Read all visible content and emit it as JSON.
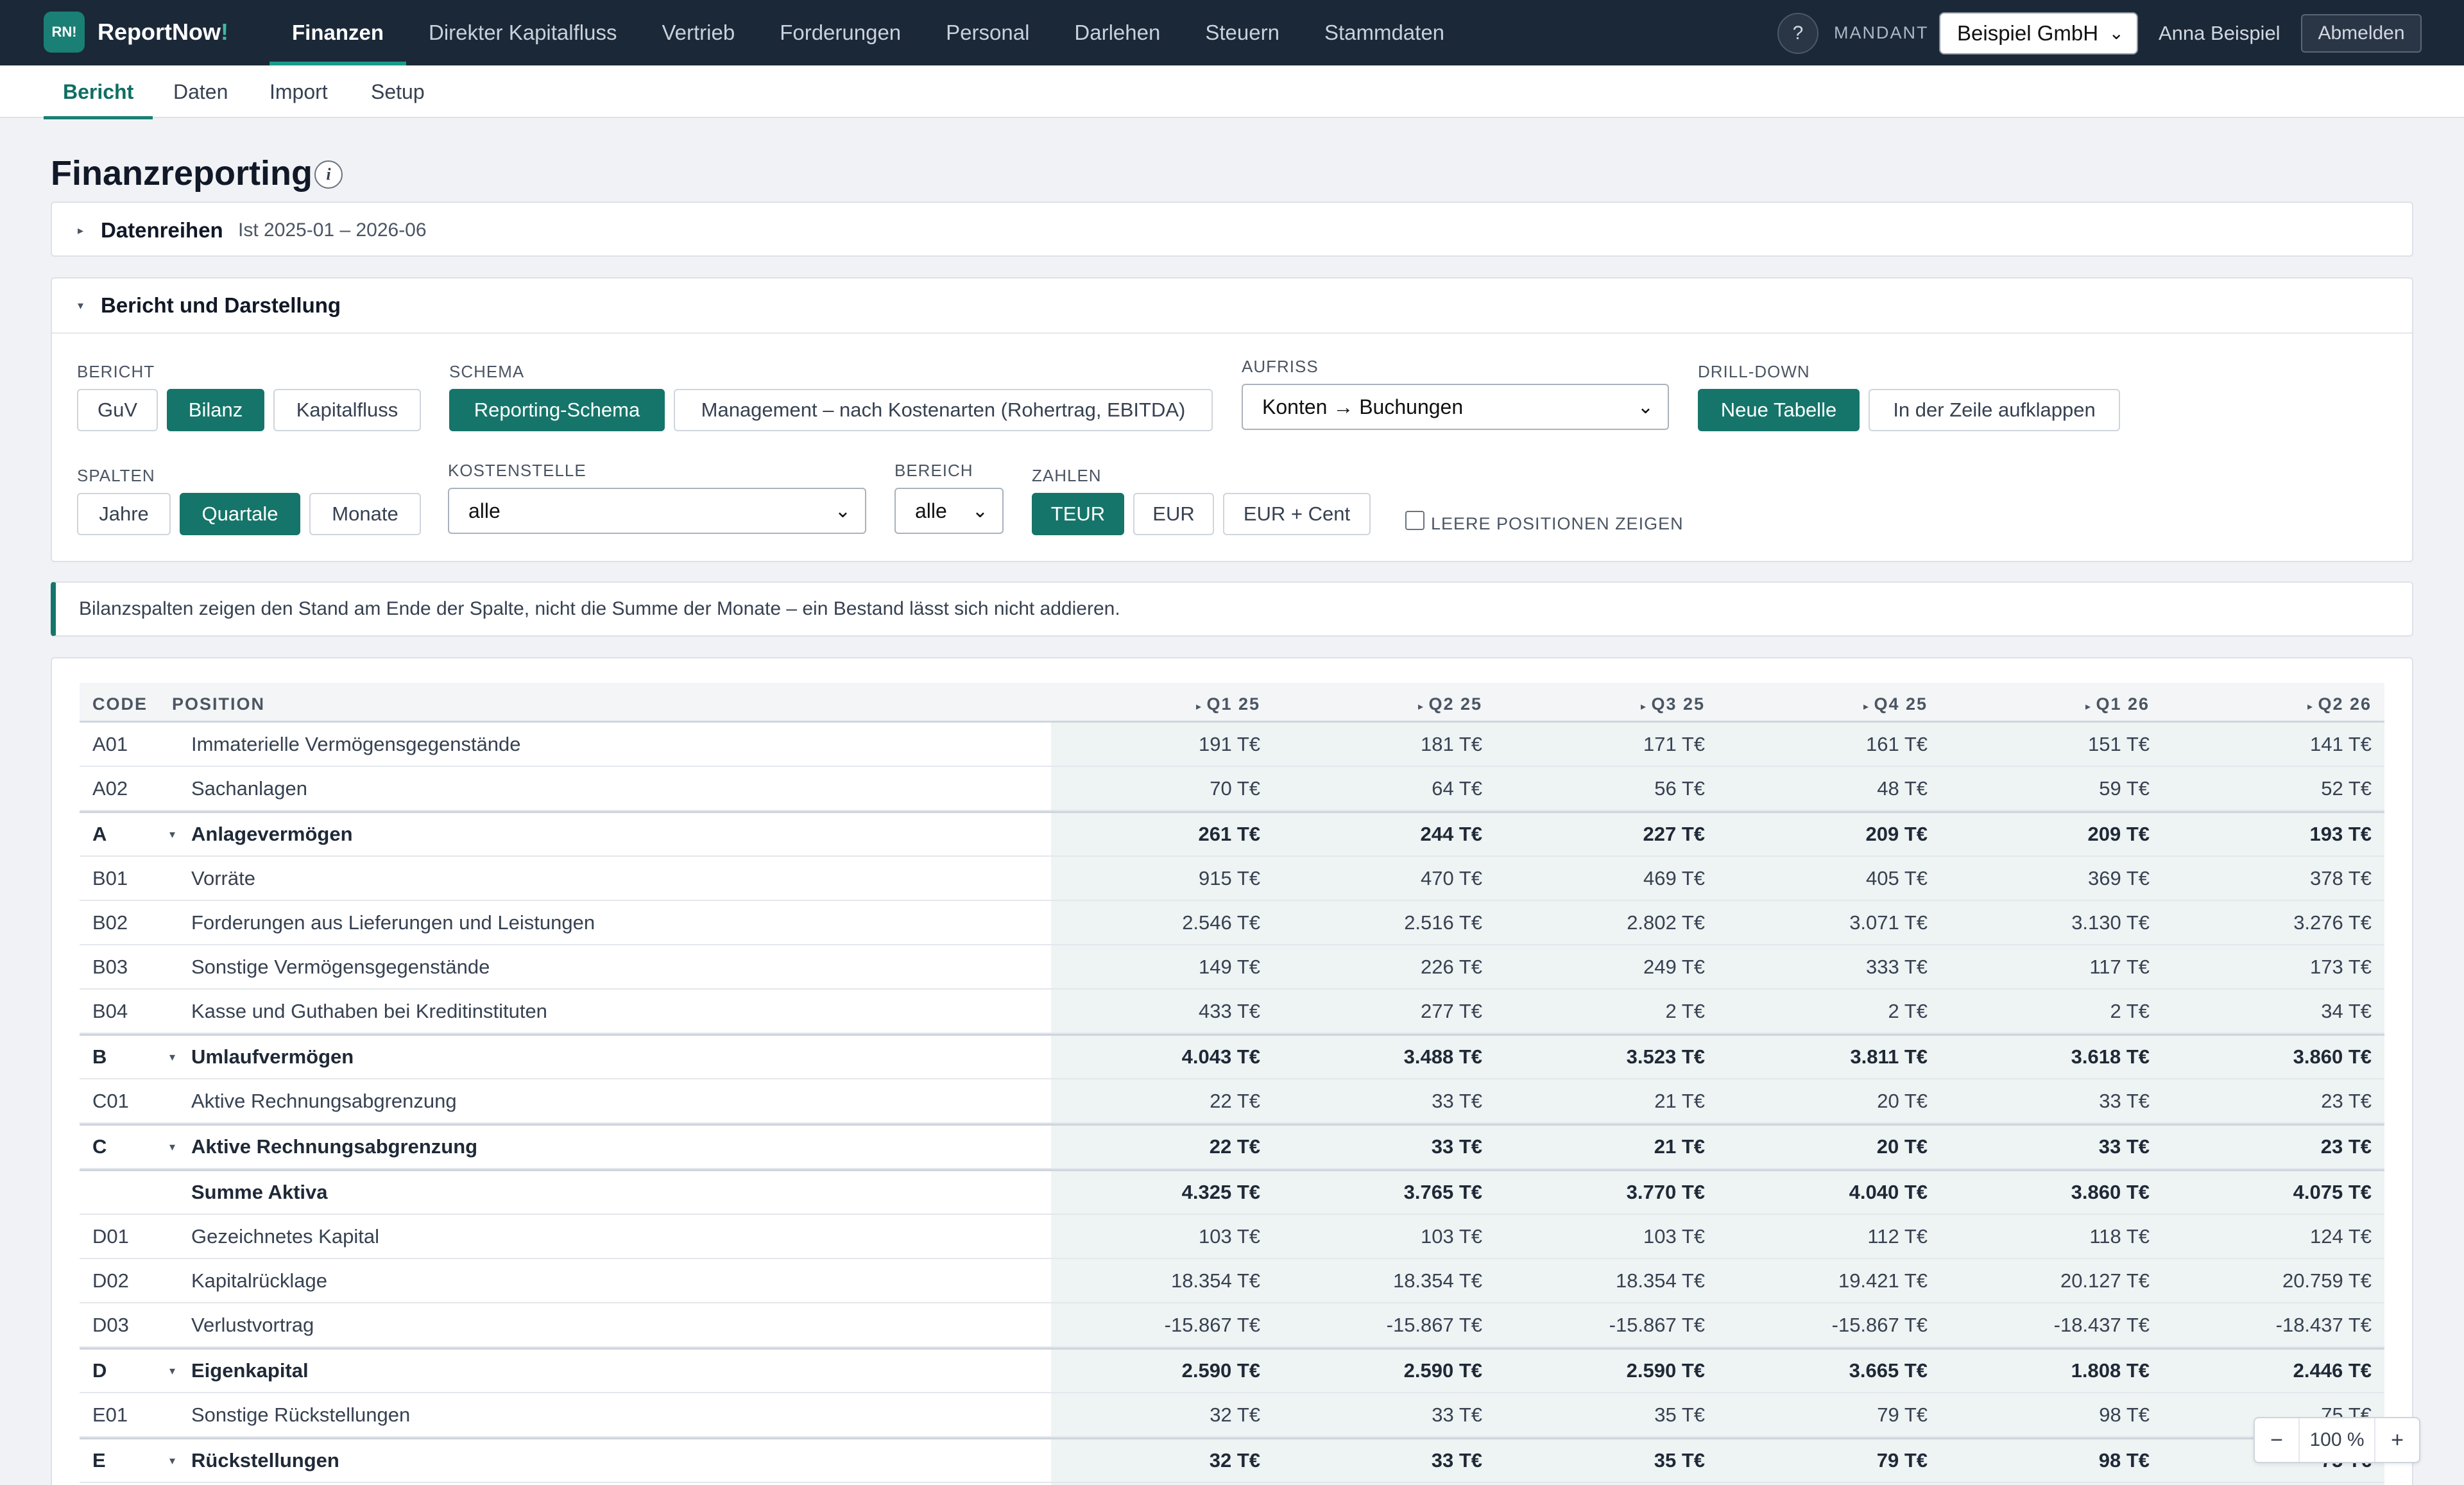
{
  "app": {
    "logo_text": "RN!",
    "brand": "ReportNow",
    "brand_bang": "!"
  },
  "nav": {
    "items": [
      "Finanzen",
      "Direkter Kapitalfluss",
      "Vertrieb",
      "Forderungen",
      "Personal",
      "Darlehen",
      "Steuern",
      "Stammdaten"
    ],
    "active": "Finanzen"
  },
  "header": {
    "help": "?",
    "mandant_label": "MANDANT",
    "mandant_value": "Beispiel GmbH",
    "user_name": "Anna Beispiel",
    "logout": "Abmelden"
  },
  "subnav": {
    "items": [
      "Bericht",
      "Daten",
      "Import",
      "Setup"
    ],
    "active": "Bericht"
  },
  "page": {
    "title": "Finanzreporting",
    "info_icon": "i"
  },
  "datenreihen": {
    "title": "Datenreihen",
    "subtitle": "Ist 2025-01 – 2026-06"
  },
  "bericht_card": {
    "title": "Bericht und Darstellung",
    "bericht": {
      "label": "BERICHT",
      "options": [
        "GuV",
        "Bilanz",
        "Kapitalfluss"
      ],
      "active": "Bilanz"
    },
    "schema": {
      "label": "SCHEMA",
      "options": [
        "Reporting-Schema",
        "Management – nach Kostenarten (Rohertrag, EBITDA)"
      ],
      "active": "Reporting-Schema"
    },
    "aufriss": {
      "label": "AUFRISS",
      "value": "Konten → Buchungen"
    },
    "drilldown": {
      "label": "DRILL-DOWN",
      "options": [
        "Neue Tabelle",
        "In der Zeile aufklappen"
      ],
      "active": "Neue Tabelle"
    },
    "spalten": {
      "label": "SPALTEN",
      "options": [
        "Jahre",
        "Quartale",
        "Monate"
      ],
      "active": "Quartale"
    },
    "kostenstelle": {
      "label": "KOSTENSTELLE",
      "value": "alle"
    },
    "bereich": {
      "label": "BEREICH",
      "value": "alle"
    },
    "zahlen": {
      "label": "ZAHLEN",
      "options": [
        "TEUR",
        "EUR",
        "EUR + Cent"
      ],
      "active": "TEUR"
    },
    "leere_positionen": {
      "label": "LEERE POSITIONEN ZEIGEN",
      "checked": false
    }
  },
  "notice": "Bilanzspalten zeigen den Stand am Ende der Spalte, nicht die Summe der Monate – ein Bestand lässt sich nicht addieren.",
  "table": {
    "headers": {
      "code": "CODE",
      "position": "POSITION"
    },
    "quarters": [
      "Q1 25",
      "Q2 25",
      "Q3 25",
      "Q4 25",
      "Q1 26",
      "Q2 26"
    ],
    "rows": [
      {
        "code": "A01",
        "position": "Immaterielle Vermögensgegenstände",
        "kind": "item",
        "values": [
          "191 T€",
          "181 T€",
          "171 T€",
          "161 T€",
          "151 T€",
          "141 T€"
        ]
      },
      {
        "code": "A02",
        "position": "Sachanlagen",
        "kind": "item",
        "values": [
          "70 T€",
          "64 T€",
          "56 T€",
          "48 T€",
          "59 T€",
          "52 T€"
        ]
      },
      {
        "code": "A",
        "position": "Anlagevermögen",
        "kind": "group",
        "values": [
          "261 T€",
          "244 T€",
          "227 T€",
          "209 T€",
          "209 T€",
          "193 T€"
        ]
      },
      {
        "code": "B01",
        "position": "Vorräte",
        "kind": "item",
        "values": [
          "915 T€",
          "470 T€",
          "469 T€",
          "405 T€",
          "369 T€",
          "378 T€"
        ]
      },
      {
        "code": "B02",
        "position": "Forderungen aus Lieferungen und Leistungen",
        "kind": "item",
        "values": [
          "2.546 T€",
          "2.516 T€",
          "2.802 T€",
          "3.071 T€",
          "3.130 T€",
          "3.276 T€"
        ]
      },
      {
        "code": "B03",
        "position": "Sonstige Vermögensgegenstände",
        "kind": "item",
        "values": [
          "149 T€",
          "226 T€",
          "249 T€",
          "333 T€",
          "117 T€",
          "173 T€"
        ]
      },
      {
        "code": "B04",
        "position": "Kasse und Guthaben bei Kreditinstituten",
        "kind": "item",
        "values": [
          "433 T€",
          "277 T€",
          "2 T€",
          "2 T€",
          "2 T€",
          "34 T€"
        ]
      },
      {
        "code": "B",
        "position": "Umlaufvermögen",
        "kind": "group",
        "values": [
          "4.043 T€",
          "3.488 T€",
          "3.523 T€",
          "3.811 T€",
          "3.618 T€",
          "3.860 T€"
        ]
      },
      {
        "code": "C01",
        "position": "Aktive Rechnungsabgrenzung",
        "kind": "item",
        "values": [
          "22 T€",
          "33 T€",
          "21 T€",
          "20 T€",
          "33 T€",
          "23 T€"
        ]
      },
      {
        "code": "C",
        "position": "Aktive Rechnungsabgrenzung",
        "kind": "group",
        "values": [
          "22 T€",
          "33 T€",
          "21 T€",
          "20 T€",
          "33 T€",
          "23 T€"
        ]
      },
      {
        "code": "",
        "position": "Summe Aktiva",
        "kind": "total",
        "values": [
          "4.325 T€",
          "3.765 T€",
          "3.770 T€",
          "4.040 T€",
          "3.860 T€",
          "4.075 T€"
        ]
      },
      {
        "code": "D01",
        "position": "Gezeichnetes Kapital",
        "kind": "item",
        "values": [
          "103 T€",
          "103 T€",
          "103 T€",
          "112 T€",
          "118 T€",
          "124 T€"
        ]
      },
      {
        "code": "D02",
        "position": "Kapitalrücklage",
        "kind": "item",
        "values": [
          "18.354 T€",
          "18.354 T€",
          "18.354 T€",
          "19.421 T€",
          "20.127 T€",
          "20.759 T€"
        ]
      },
      {
        "code": "D03",
        "position": "Verlustvortrag",
        "kind": "item",
        "values": [
          "-15.867 T€",
          "-15.867 T€",
          "-15.867 T€",
          "-15.867 T€",
          "-18.437 T€",
          "-18.437 T€"
        ]
      },
      {
        "code": "D",
        "position": "Eigenkapital",
        "kind": "group",
        "values": [
          "2.590 T€",
          "2.590 T€",
          "2.590 T€",
          "3.665 T€",
          "1.808 T€",
          "2.446 T€"
        ]
      },
      {
        "code": "E01",
        "position": "Sonstige Rückstellungen",
        "kind": "item",
        "values": [
          "32 T€",
          "33 T€",
          "35 T€",
          "79 T€",
          "98 T€",
          "75 T€"
        ]
      },
      {
        "code": "E",
        "position": "Rückstellungen",
        "kind": "group",
        "values": [
          "32 T€",
          "33 T€",
          "35 T€",
          "79 T€",
          "98 T€",
          "75 T€"
        ]
      }
    ]
  },
  "zoom": {
    "minus": "−",
    "value": "100 %",
    "plus": "+"
  }
}
